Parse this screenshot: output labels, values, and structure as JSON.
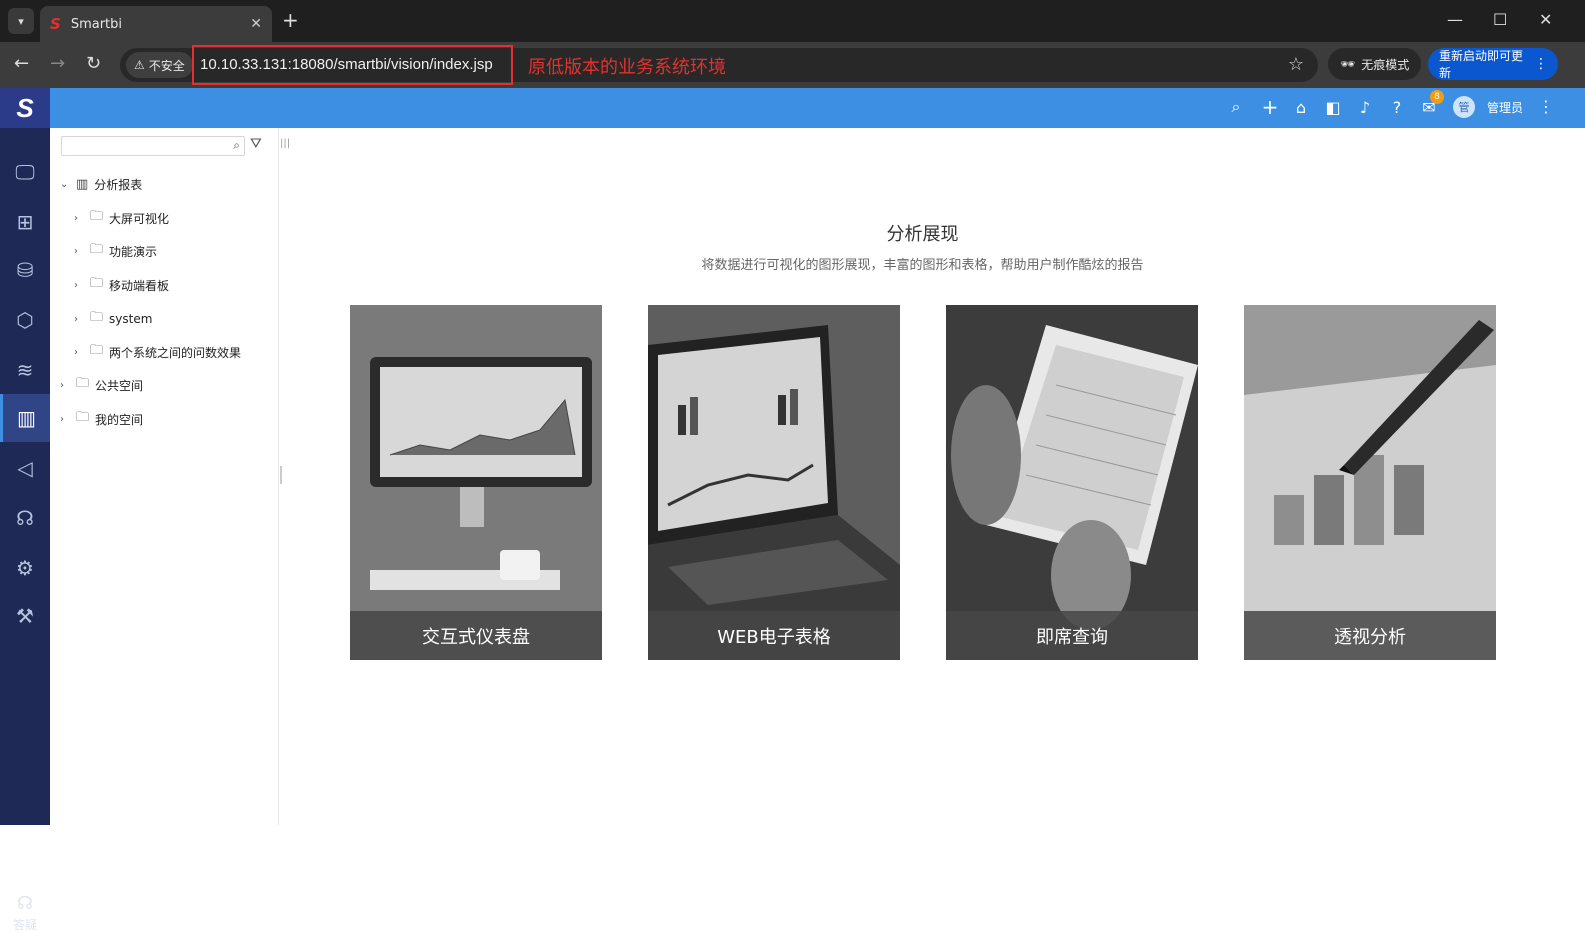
{
  "browser": {
    "tab_title": "Smartbi",
    "tab_favicon": "S",
    "insecure_label": "不安全",
    "url": "10.10.33.131:18080/smartbi/vision/index.jsp",
    "annotation": "原低版本的业务系统环境",
    "incognito_label": "无痕模式",
    "update_label": "重新启动即可更新"
  },
  "header": {
    "logo": "S",
    "badge_count": "8",
    "avatar_text": "管",
    "user_name": "管理员"
  },
  "leftnav": {
    "help_label": "答疑"
  },
  "tree": {
    "nodes": [
      {
        "label": "分析报表"
      },
      {
        "label": "大屏可视化"
      },
      {
        "label": "功能演示"
      },
      {
        "label": "移动端看板"
      },
      {
        "label": "system"
      },
      {
        "label": "两个系统之间的问数效果"
      },
      {
        "label": "公共空间"
      },
      {
        "label": "我的空间"
      }
    ]
  },
  "main": {
    "title": "分析展现",
    "subtitle": "将数据进行可视化的图形展现，丰富的图形和表格，帮助用户制作酷炫的报告",
    "cards": [
      {
        "label": "交互式仪表盘"
      },
      {
        "label": "WEB电子表格"
      },
      {
        "label": "即席查询"
      },
      {
        "label": "透视分析"
      }
    ]
  },
  "colors": {
    "header_blue": "#3d8fe3",
    "nav_dark": "#1e2a55",
    "annotation_red": "#e3312d",
    "update_blue": "#0b57d0"
  }
}
